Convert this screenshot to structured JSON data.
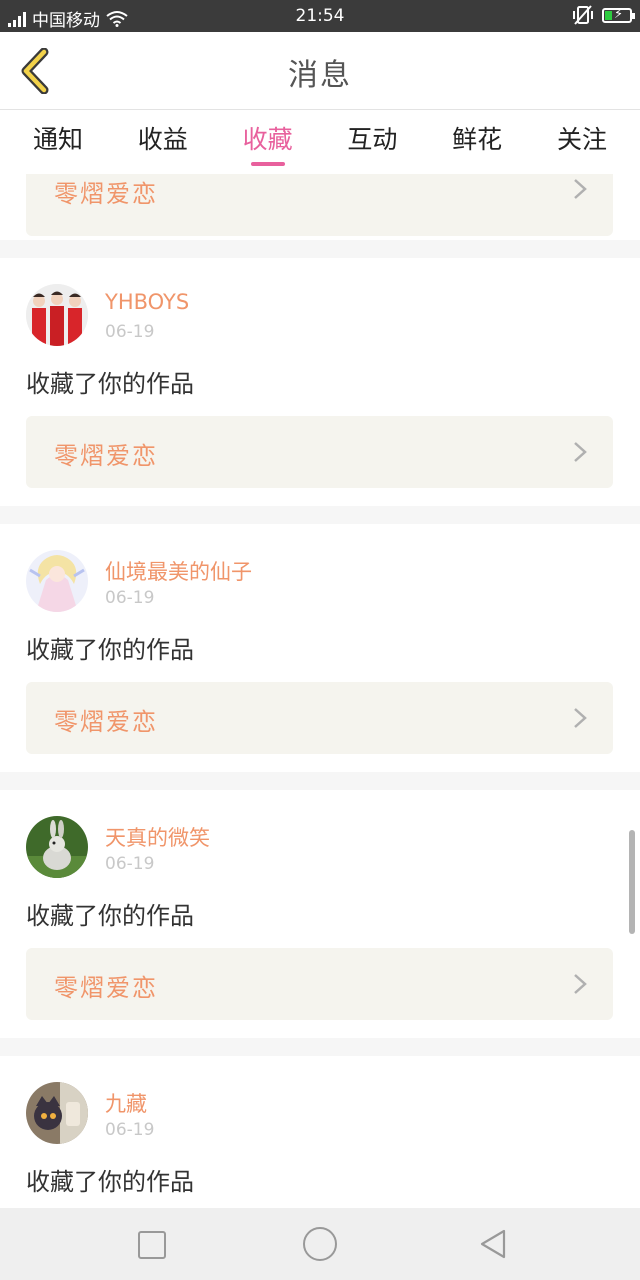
{
  "status_bar": {
    "carrier": "中国移动",
    "time": "21:54",
    "icons": [
      "signal-icon",
      "wifi-icon",
      "vibrate-mute-icon",
      "battery-charging-icon"
    ]
  },
  "header": {
    "title": "消息",
    "back_icon": "chevron-left-icon"
  },
  "tabs": [
    {
      "label": "通知",
      "active": false
    },
    {
      "label": "收益",
      "active": false
    },
    {
      "label": "收藏",
      "active": true
    },
    {
      "label": "互动",
      "active": false
    },
    {
      "label": "鲜花",
      "active": false
    },
    {
      "label": "关注",
      "active": false
    }
  ],
  "colors": {
    "accent": "#e8609d",
    "username": "#f0956a",
    "work_bg": "#f5f4ee"
  },
  "partial_top_card": {
    "work_title": "零熠爱恋"
  },
  "items": [
    {
      "username": "YHBOYS",
      "date": "06-19",
      "action": "收藏了你的作品",
      "work_title": "零熠爱恋",
      "avatar": "group-photo-avatar"
    },
    {
      "username": "仙境最美的仙子",
      "date": "06-19",
      "action": "收藏了你的作品",
      "work_title": "零熠爱恋",
      "avatar": "anime-fairy-avatar"
    },
    {
      "username": "天真的微笑",
      "date": "06-19",
      "action": "收藏了你的作品",
      "work_title": "零熠爱恋",
      "avatar": "rabbit-avatar"
    },
    {
      "username": "九藏",
      "date": "06-19",
      "action": "收藏了你的作品",
      "avatar": "cartoon-avatar"
    }
  ],
  "nav_bar": [
    "recent-apps-icon",
    "home-icon",
    "back-triangle-icon"
  ]
}
